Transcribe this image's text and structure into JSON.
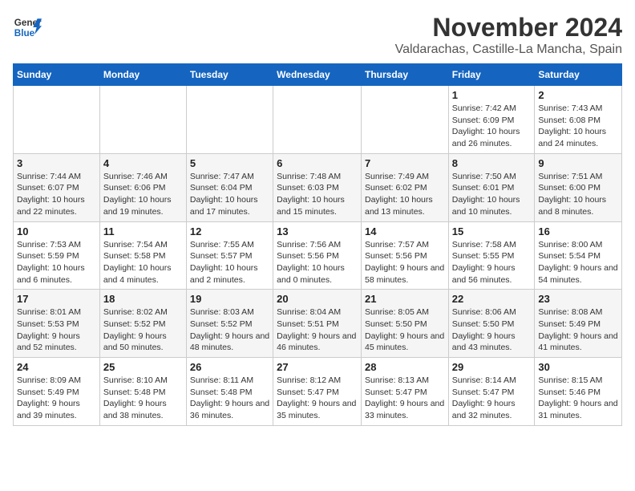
{
  "logo": {
    "line1": "General",
    "line2": "Blue"
  },
  "title": "November 2024",
  "subtitle": "Valdarachas, Castille-La Mancha, Spain",
  "weekdays": [
    "Sunday",
    "Monday",
    "Tuesday",
    "Wednesday",
    "Thursday",
    "Friday",
    "Saturday"
  ],
  "weeks": [
    [
      {
        "day": "",
        "info": ""
      },
      {
        "day": "",
        "info": ""
      },
      {
        "day": "",
        "info": ""
      },
      {
        "day": "",
        "info": ""
      },
      {
        "day": "",
        "info": ""
      },
      {
        "day": "1",
        "info": "Sunrise: 7:42 AM\nSunset: 6:09 PM\nDaylight: 10 hours and 26 minutes."
      },
      {
        "day": "2",
        "info": "Sunrise: 7:43 AM\nSunset: 6:08 PM\nDaylight: 10 hours and 24 minutes."
      }
    ],
    [
      {
        "day": "3",
        "info": "Sunrise: 7:44 AM\nSunset: 6:07 PM\nDaylight: 10 hours and 22 minutes."
      },
      {
        "day": "4",
        "info": "Sunrise: 7:46 AM\nSunset: 6:06 PM\nDaylight: 10 hours and 19 minutes."
      },
      {
        "day": "5",
        "info": "Sunrise: 7:47 AM\nSunset: 6:04 PM\nDaylight: 10 hours and 17 minutes."
      },
      {
        "day": "6",
        "info": "Sunrise: 7:48 AM\nSunset: 6:03 PM\nDaylight: 10 hours and 15 minutes."
      },
      {
        "day": "7",
        "info": "Sunrise: 7:49 AM\nSunset: 6:02 PM\nDaylight: 10 hours and 13 minutes."
      },
      {
        "day": "8",
        "info": "Sunrise: 7:50 AM\nSunset: 6:01 PM\nDaylight: 10 hours and 10 minutes."
      },
      {
        "day": "9",
        "info": "Sunrise: 7:51 AM\nSunset: 6:00 PM\nDaylight: 10 hours and 8 minutes."
      }
    ],
    [
      {
        "day": "10",
        "info": "Sunrise: 7:53 AM\nSunset: 5:59 PM\nDaylight: 10 hours and 6 minutes."
      },
      {
        "day": "11",
        "info": "Sunrise: 7:54 AM\nSunset: 5:58 PM\nDaylight: 10 hours and 4 minutes."
      },
      {
        "day": "12",
        "info": "Sunrise: 7:55 AM\nSunset: 5:57 PM\nDaylight: 10 hours and 2 minutes."
      },
      {
        "day": "13",
        "info": "Sunrise: 7:56 AM\nSunset: 5:56 PM\nDaylight: 10 hours and 0 minutes."
      },
      {
        "day": "14",
        "info": "Sunrise: 7:57 AM\nSunset: 5:56 PM\nDaylight: 9 hours and 58 minutes."
      },
      {
        "day": "15",
        "info": "Sunrise: 7:58 AM\nSunset: 5:55 PM\nDaylight: 9 hours and 56 minutes."
      },
      {
        "day": "16",
        "info": "Sunrise: 8:00 AM\nSunset: 5:54 PM\nDaylight: 9 hours and 54 minutes."
      }
    ],
    [
      {
        "day": "17",
        "info": "Sunrise: 8:01 AM\nSunset: 5:53 PM\nDaylight: 9 hours and 52 minutes."
      },
      {
        "day": "18",
        "info": "Sunrise: 8:02 AM\nSunset: 5:52 PM\nDaylight: 9 hours and 50 minutes."
      },
      {
        "day": "19",
        "info": "Sunrise: 8:03 AM\nSunset: 5:52 PM\nDaylight: 9 hours and 48 minutes."
      },
      {
        "day": "20",
        "info": "Sunrise: 8:04 AM\nSunset: 5:51 PM\nDaylight: 9 hours and 46 minutes."
      },
      {
        "day": "21",
        "info": "Sunrise: 8:05 AM\nSunset: 5:50 PM\nDaylight: 9 hours and 45 minutes."
      },
      {
        "day": "22",
        "info": "Sunrise: 8:06 AM\nSunset: 5:50 PM\nDaylight: 9 hours and 43 minutes."
      },
      {
        "day": "23",
        "info": "Sunrise: 8:08 AM\nSunset: 5:49 PM\nDaylight: 9 hours and 41 minutes."
      }
    ],
    [
      {
        "day": "24",
        "info": "Sunrise: 8:09 AM\nSunset: 5:49 PM\nDaylight: 9 hours and 39 minutes."
      },
      {
        "day": "25",
        "info": "Sunrise: 8:10 AM\nSunset: 5:48 PM\nDaylight: 9 hours and 38 minutes."
      },
      {
        "day": "26",
        "info": "Sunrise: 8:11 AM\nSunset: 5:48 PM\nDaylight: 9 hours and 36 minutes."
      },
      {
        "day": "27",
        "info": "Sunrise: 8:12 AM\nSunset: 5:47 PM\nDaylight: 9 hours and 35 minutes."
      },
      {
        "day": "28",
        "info": "Sunrise: 8:13 AM\nSunset: 5:47 PM\nDaylight: 9 hours and 33 minutes."
      },
      {
        "day": "29",
        "info": "Sunrise: 8:14 AM\nSunset: 5:47 PM\nDaylight: 9 hours and 32 minutes."
      },
      {
        "day": "30",
        "info": "Sunrise: 8:15 AM\nSunset: 5:46 PM\nDaylight: 9 hours and 31 minutes."
      }
    ]
  ]
}
